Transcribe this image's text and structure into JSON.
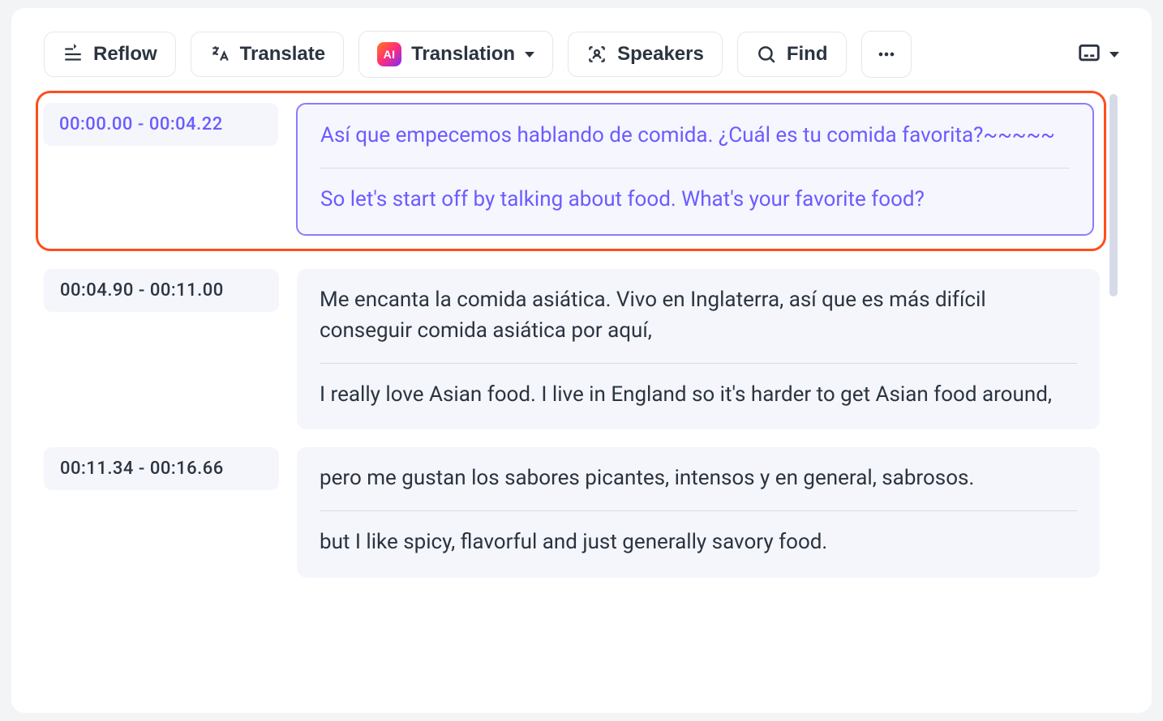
{
  "toolbar": {
    "reflow": "Reflow",
    "translate": "Translate",
    "translation": "Translation",
    "speakers": "Speakers",
    "find": "Find"
  },
  "segments": [
    {
      "timestamp": "00:00.00 - 00:04.22",
      "source": "Así que empecemos hablando de comida. ¿Cuál es tu comida favorita?~~~~~",
      "target": "So let's start off by talking about food. What's your favorite food?"
    },
    {
      "timestamp": "00:04.90  -  00:11.00",
      "source": "Me encanta la comida asiática. Vivo en Inglaterra, así que es más difícil conseguir comida asiática por aquí,",
      "target": "I really love Asian food. I live in England so it's harder to get Asian food around,"
    },
    {
      "timestamp": "00:11.34  -  00:16.66",
      "source": "pero me gustan los sabores picantes, intensos y en general, sabrosos.",
      "target": "but I like spicy, flavorful and just generally savory food."
    }
  ]
}
